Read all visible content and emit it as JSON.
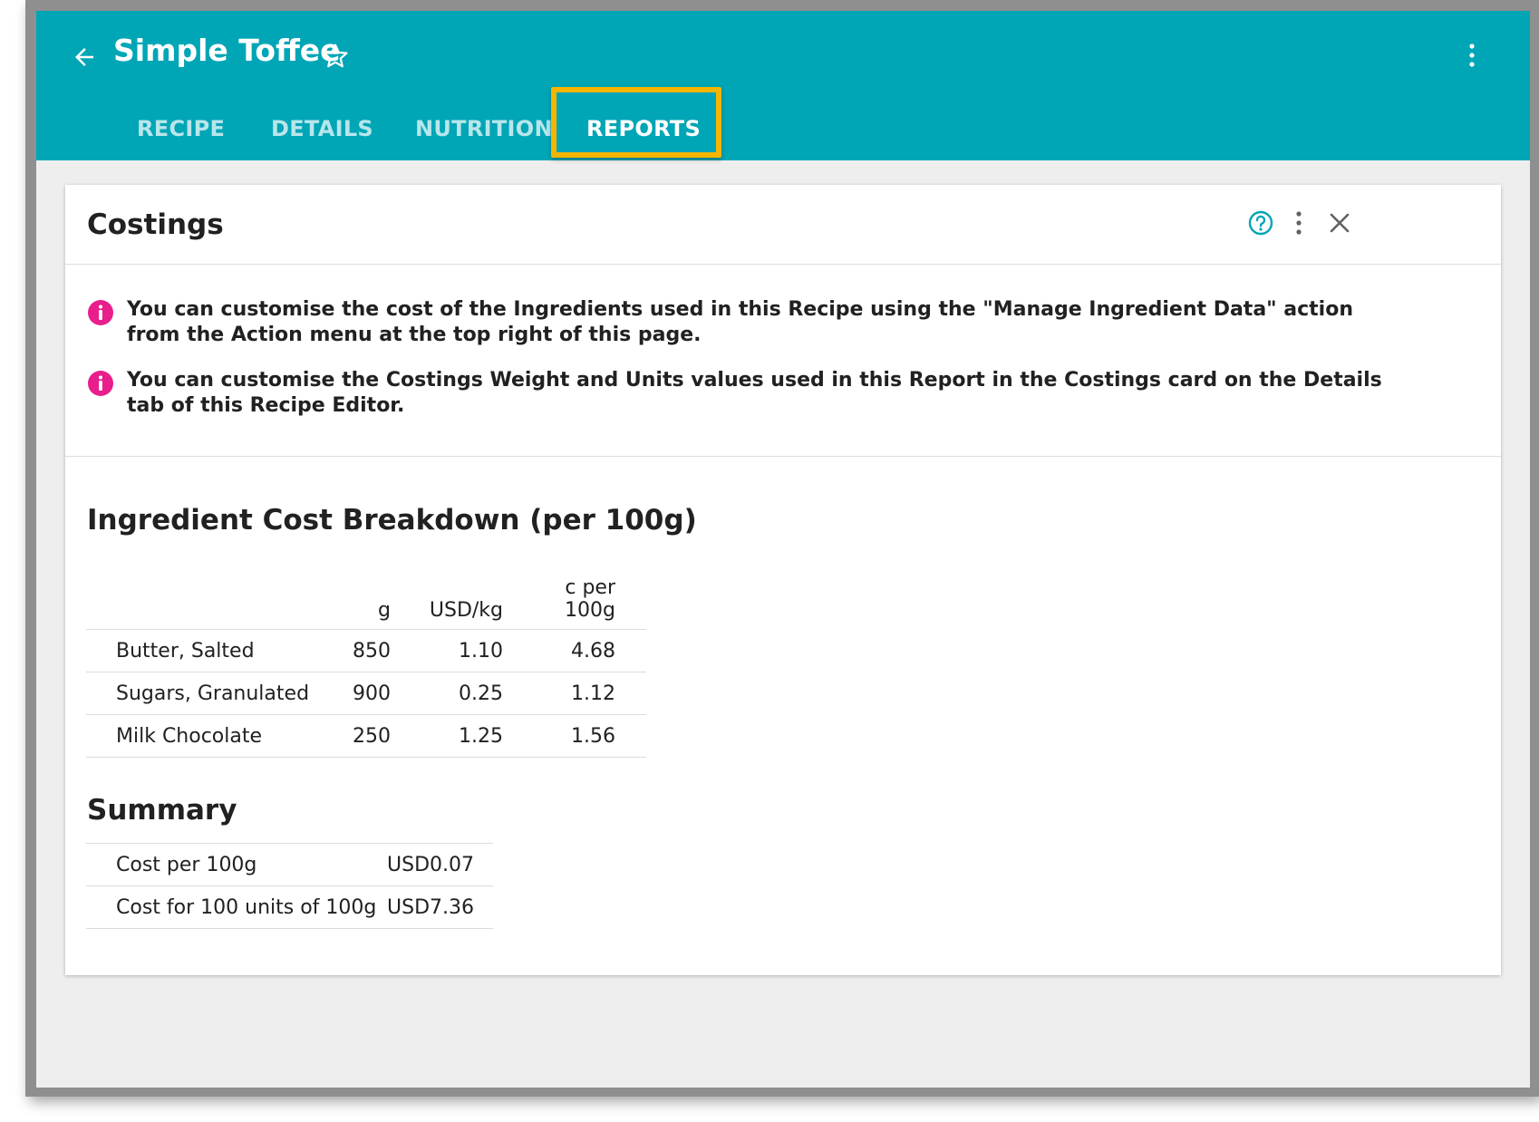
{
  "header": {
    "title": "Simple Toffee",
    "tabs": [
      {
        "label": "RECIPE",
        "active": false
      },
      {
        "label": "DETAILS",
        "active": false
      },
      {
        "label": "NUTRITION",
        "active": false
      },
      {
        "label": "REPORTS",
        "active": true
      }
    ],
    "icons": [
      "arrow-back-icon",
      "star-outline-icon",
      "more-vertical-icon"
    ]
  },
  "card": {
    "title": "Costings",
    "icons": [
      "help-icon",
      "more-vertical-icon",
      "close-icon"
    ],
    "notes": [
      "You can customise the cost of the Ingredients used in this Recipe using the \"Manage Ingredient Data\" action from the Action menu at the top right of this page.",
      "You can customise the Costings Weight and Units values used in this Report in the Costings card on the Details tab of this Recipe Editor."
    ]
  },
  "breakdown": {
    "title": "Ingredient Cost Breakdown (per 100g)",
    "columns": [
      "",
      "g",
      "USD/kg",
      "c per 100g"
    ],
    "rows": [
      [
        "Butter, Salted",
        "850",
        "1.10",
        "4.68"
      ],
      [
        "Sugars, Granulated",
        "900",
        "0.25",
        "1.12"
      ],
      [
        "Milk Chocolate",
        "250",
        "1.25",
        "1.56"
      ]
    ]
  },
  "summary": {
    "title": "Summary",
    "rows": [
      [
        "Cost per 100g",
        "USD0.07"
      ],
      [
        "Cost for 100 units of 100g",
        "USD7.36"
      ]
    ]
  },
  "colors": {
    "appbar": "#00a6b6",
    "highlight": "#f7b500",
    "info": "#e91e8c",
    "help": "#00a6b6"
  }
}
